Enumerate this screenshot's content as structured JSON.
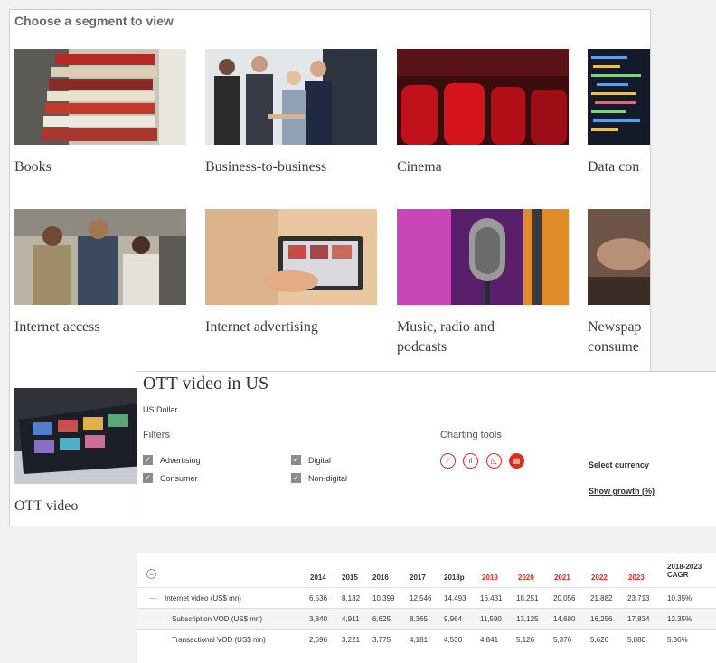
{
  "segments": {
    "heading": "Choose a segment to view",
    "items": [
      {
        "label": "Books"
      },
      {
        "label": "Business-to-business"
      },
      {
        "label": "Cinema"
      },
      {
        "label": "Data con"
      },
      {
        "label": "Internet access"
      },
      {
        "label": "Internet advertising"
      },
      {
        "label": "Music, radio and",
        "label2": "podcasts"
      },
      {
        "label": "Newspap",
        "label2": "consume"
      },
      {
        "label": "OTT video"
      }
    ]
  },
  "ott": {
    "title": "OTT video in US",
    "currency": "US Dollar",
    "filters_heading": "Filters",
    "filters": [
      {
        "label": "Advertising",
        "checked": true
      },
      {
        "label": "Consumer",
        "checked": true
      },
      {
        "label": "Digital",
        "checked": true
      },
      {
        "label": "Non-digital",
        "checked": true
      }
    ],
    "charting_heading": "Charting tools",
    "tools": [
      {
        "icon": "line-chart-icon",
        "glyph": "⟋"
      },
      {
        "icon": "bar-chart-icon",
        "glyph": "ıl"
      },
      {
        "icon": "area-chart-icon",
        "glyph": "◺"
      },
      {
        "icon": "table-view-icon",
        "glyph": "▤"
      }
    ],
    "select_currency": "Select currency",
    "show_growth": "Show growth (%)",
    "collapse_glyph": "−",
    "columns": [
      "2014",
      "2015",
      "2016",
      "2017",
      "2018p",
      "2019",
      "2020",
      "2021",
      "2022",
      "2023"
    ],
    "cagr_header": [
      "2018-2023",
      "CAGR"
    ],
    "rows": [
      {
        "label": "Internet video (US$ mn)",
        "values": [
          "6,536",
          "8,132",
          "10,399",
          "12,546",
          "14,493",
          "16,431",
          "18,251",
          "20,056",
          "21,882",
          "23,713"
        ],
        "cagr": "10.35%"
      },
      {
        "label": "Subscription VOD (US$ mn)",
        "values": [
          "3,840",
          "4,911",
          "6,625",
          "8,365",
          "9,964",
          "11,590",
          "13,125",
          "14,680",
          "16,256",
          "17,834"
        ],
        "cagr": "12.35%"
      },
      {
        "label": "Transactional VOD (US$ mn)",
        "values": [
          "2,696",
          "3,221",
          "3,775",
          "4,181",
          "4,530",
          "4,841",
          "5,126",
          "5,376",
          "5,626",
          "5,880"
        ],
        "cagr": "5.36%"
      }
    ],
    "colors": {
      "accent": "#e02b20"
    }
  }
}
